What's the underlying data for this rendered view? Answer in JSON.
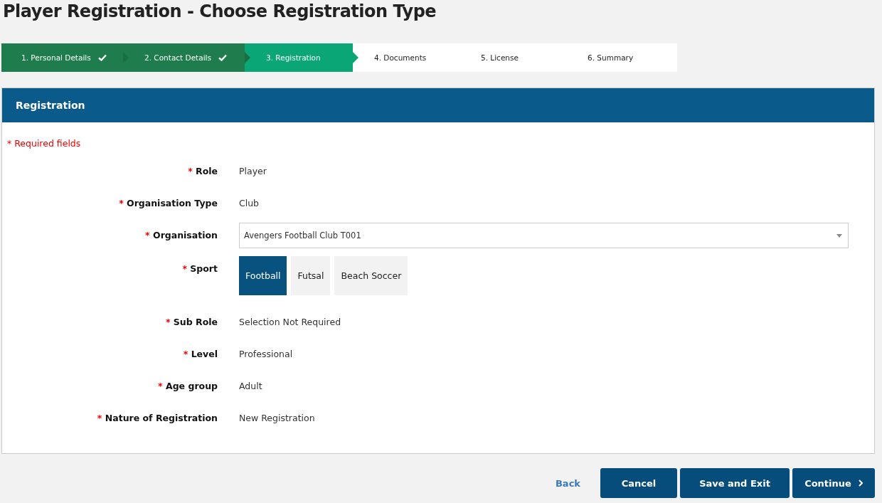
{
  "page_title": "Player Registration - Choose Registration Type",
  "steps": [
    {
      "label": "1. Personal Details",
      "completed": true,
      "selected": false
    },
    {
      "label": "2. Contact Details",
      "completed": true,
      "selected": false
    },
    {
      "label": "3. Registration",
      "completed": false,
      "selected": true
    },
    {
      "label": "4. Documents",
      "completed": false,
      "selected": false
    },
    {
      "label": "5. License",
      "completed": false,
      "selected": false
    },
    {
      "label": "6. Summary",
      "completed": false,
      "selected": false
    }
  ],
  "panel": {
    "title": "Registration",
    "required_note": "* Required fields",
    "fields": [
      {
        "kind": "text",
        "mark": "*",
        "label": "Role",
        "value": "Player"
      },
      {
        "kind": "text",
        "mark": "*",
        "label": "Organisation Type",
        "value": "Club"
      },
      {
        "kind": "select",
        "mark": "*",
        "label": "Organisation",
        "value": "Avengers Football Club T001"
      },
      {
        "kind": "choice",
        "mark": "*",
        "label": "Sport",
        "options": [
          {
            "label": "Football",
            "selected": true
          },
          {
            "label": "Futsal",
            "selected": false
          },
          {
            "label": "Beach Soccer",
            "selected": false
          }
        ]
      },
      {
        "kind": "text",
        "mark": "*",
        "label": "Sub Role",
        "value": "Selection Not Required"
      },
      {
        "kind": "text",
        "mark": "*",
        "label": "Level",
        "value": "Professional"
      },
      {
        "kind": "text",
        "mark": "*",
        "label": "Age group",
        "value": "Adult"
      },
      {
        "kind": "text",
        "mark": "*",
        "label": "Nature of Registration",
        "value": "New Registration"
      }
    ]
  },
  "actions": {
    "back": "Back",
    "buttons": [
      {
        "label": "Cancel",
        "kind": "plain"
      },
      {
        "label": "Save and Exit",
        "kind": "plain"
      },
      {
        "label": "Continue",
        "kind": "next"
      }
    ]
  }
}
